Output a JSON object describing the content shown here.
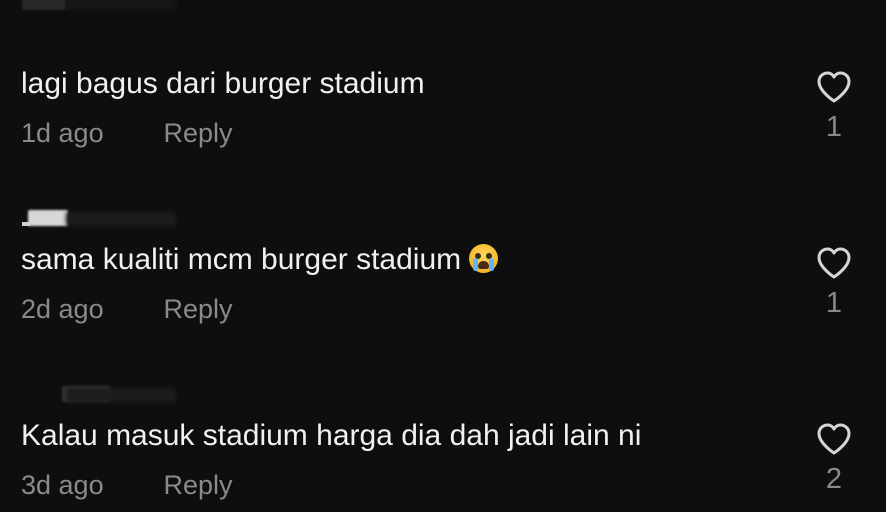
{
  "comments": [
    {
      "text": "lagi bagus dari burger stadium",
      "time": "1d ago",
      "reply_label": "Reply",
      "likes": "1",
      "emoji": null
    },
    {
      "text": "sama kualiti mcm burger stadium",
      "time": "2d ago",
      "reply_label": "Reply",
      "likes": "1",
      "emoji": "loudly-crying-face"
    },
    {
      "text": "Kalau masuk stadium harga dia dah jadi lain ni",
      "time": "3d ago",
      "reply_label": "Reply",
      "likes": "2",
      "emoji": null
    }
  ],
  "colors": {
    "background": "#0e0e0e",
    "text": "#f1f1f1",
    "muted": "#8a8a8a"
  },
  "icons": {
    "like": "heart-outline-icon"
  }
}
